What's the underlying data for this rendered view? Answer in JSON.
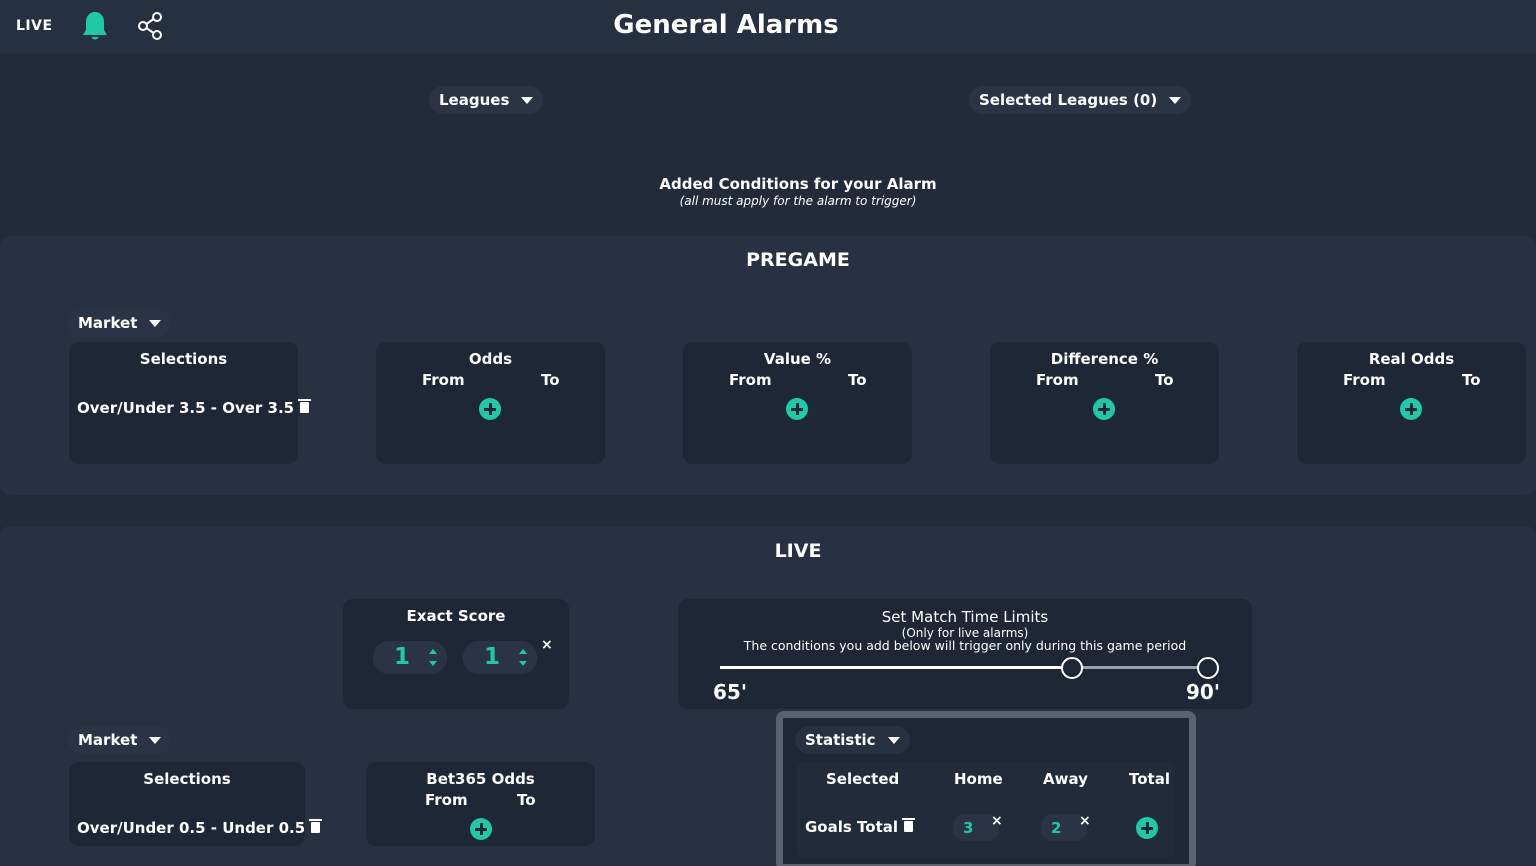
{
  "header": {
    "live_label": "LIVE",
    "title": "General Alarms",
    "icons": [
      "bell-icon",
      "share-icon"
    ],
    "accent_color": "#1fc9a6"
  },
  "filters": {
    "leagues_label": "Leagues",
    "selected_leagues_label": "Selected Leagues (0)"
  },
  "conditions": {
    "title": "Added Conditions for your Alarm",
    "subtitle": "(all must apply for the alarm to trigger)"
  },
  "pregame": {
    "title": "PREGAME",
    "market_label": "Market",
    "selections": {
      "title": "Selections",
      "items": [
        "Over/Under 3.5 - Over 3.5"
      ]
    },
    "cards": [
      {
        "title": "Odds",
        "from": "From",
        "to": "To"
      },
      {
        "title": "Value %",
        "from": "From",
        "to": "To"
      },
      {
        "title": "Difference %",
        "from": "From",
        "to": "To"
      },
      {
        "title": "Real Odds",
        "from": "From",
        "to": "To"
      }
    ]
  },
  "live": {
    "title": "LIVE",
    "exact_score": {
      "title": "Exact Score",
      "home": "1",
      "away": "1"
    },
    "time_limits": {
      "title": "Set Match Time Limits",
      "note": "(Only for live alarms)",
      "description": "The conditions you add below will trigger only during this game period",
      "from_label": "65'",
      "to_label": "90'",
      "from_minute": 65,
      "to_minute": 90,
      "max_minute": 90
    },
    "market_label": "Market",
    "selections": {
      "title": "Selections",
      "items": [
        "Over/Under 0.5 - Under 0.5"
      ]
    },
    "bet365": {
      "title": "Bet365 Odds",
      "from": "From",
      "to": "To"
    },
    "statistic": {
      "label": "Statistic",
      "headers": [
        "Selected",
        "Home",
        "Away",
        "Total"
      ],
      "row": {
        "name": "Goals Total",
        "home": "3",
        "away": "2"
      }
    }
  }
}
